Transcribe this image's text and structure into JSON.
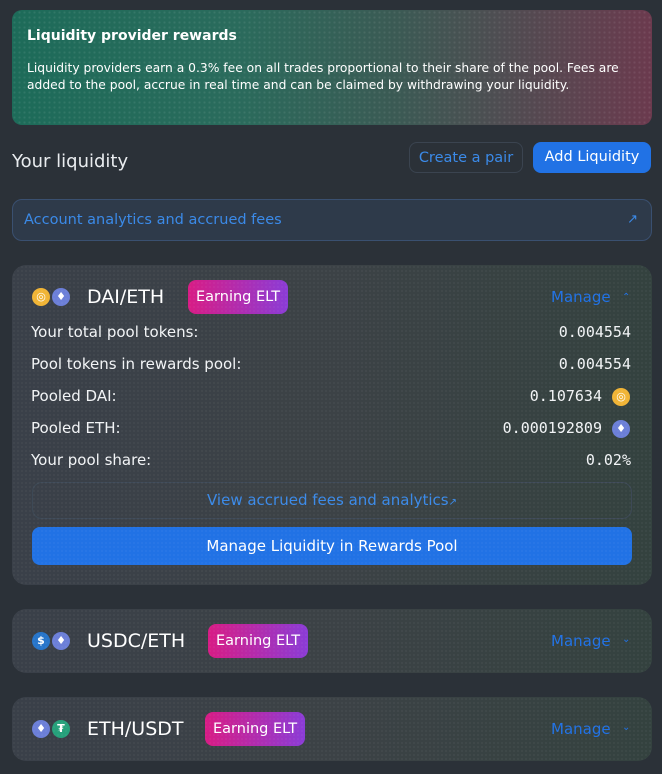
{
  "banner": {
    "title": "Liquidity provider rewards",
    "text": "Liquidity providers earn a 0.3% fee on all trades proportional to their share of the pool. Fees are added to the pool, accrue in real time and can be claimed by withdrawing your liquidity."
  },
  "header": {
    "title": "Your liquidity",
    "create_pair": "Create a pair",
    "add_liquidity": "Add Liquidity"
  },
  "analytics_link": {
    "label": "Account analytics and accrued fees",
    "icon": "external-arrow-icon"
  },
  "positions": [
    {
      "pair": "DAI/ETH",
      "badge": "Earning ELT",
      "manage": "Manage",
      "expanded": true,
      "rows": [
        {
          "label": "Your total pool tokens:",
          "value": "0.004554"
        },
        {
          "label": "Pool tokens in rewards pool:",
          "value": "0.004554"
        },
        {
          "label": "Pooled DAI:",
          "value": "0.107634"
        },
        {
          "label": "Pooled ETH:",
          "value": "0.000192809"
        },
        {
          "label": "Your pool share:",
          "value": "0.02%"
        }
      ],
      "fees_link": "View accrued fees and analytics",
      "fees_link_arrow": "↗",
      "manage_pool_button": "Manage Liquidity in Rewards Pool"
    },
    {
      "pair": "USDC/ETH",
      "badge": "Earning ELT",
      "manage": "Manage",
      "expanded": false
    },
    {
      "pair": "ETH/USDT",
      "badge": "Earning ELT",
      "manage": "Manage",
      "expanded": false
    }
  ],
  "icons": {
    "up": "chevron-up-icon",
    "down": "chevron-down-icon",
    "dai": "dai-token-icon",
    "eth": "eth-token-icon",
    "usdc": "usdc-token-icon",
    "usdt": "usdt-token-icon"
  },
  "colors": {
    "accent": "#2172e5",
    "link": "#3b8ae8",
    "badge_start": "#d81c85",
    "badge_end": "#8b3cd6"
  }
}
